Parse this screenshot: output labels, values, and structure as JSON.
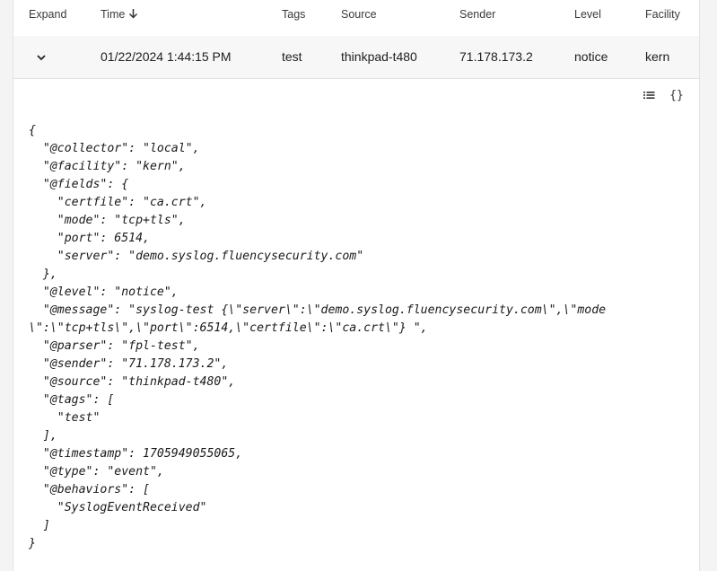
{
  "table": {
    "headers": {
      "expand": "Expand",
      "time": "Time",
      "tags": "Tags",
      "source": "Source",
      "sender": "Sender",
      "level": "Level",
      "facility": "Facility"
    },
    "row": {
      "time": "01/22/2024 1:44:15 PM",
      "tags": "test",
      "source": "thinkpad-t480",
      "sender": "71.178.173.2",
      "level": "notice",
      "facility": "kern"
    }
  },
  "view_buttons": {
    "list_icon": "list-icon",
    "json_icon": "braces-icon",
    "json_label": "{}"
  },
  "json_lines": [
    "{",
    "  \"@collector\": \"local\",",
    "  \"@facility\": \"kern\",",
    "  \"@fields\": {",
    "    \"certfile\": \"ca.crt\",",
    "    \"mode\": \"tcp+tls\",",
    "    \"port\": 6514,",
    "    \"server\": \"demo.syslog.fluencysecurity.com\"",
    "  },",
    "  \"@level\": \"notice\",",
    "  \"@message\": \"syslog-test {\\\"server\\\":\\\"demo.syslog.fluencysecurity.com\\\",\\\"mode",
    "\\\":\\\"tcp+tls\\\",\\\"port\\\":6514,\\\"certfile\\\":\\\"ca.crt\\\"} \",",
    "  \"@parser\": \"fpl-test\",",
    "  \"@sender\": \"71.178.173.2\",",
    "  \"@source\": \"thinkpad-t480\",",
    "  \"@tags\": [",
    "    \"test\"",
    "  ],",
    "  \"@timestamp\": 1705949055065,",
    "  \"@type\": \"event\",",
    "  \"@behaviors\": [",
    "    \"SyslogEventReceived\"",
    "  ]",
    "}"
  ]
}
